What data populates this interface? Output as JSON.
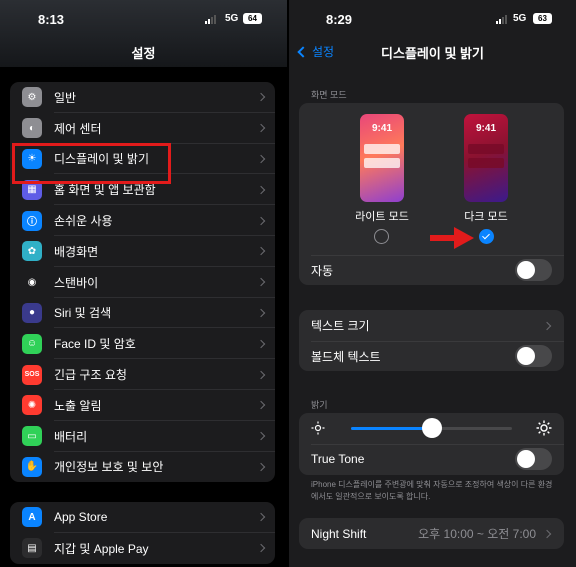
{
  "left": {
    "status": {
      "time": "8:13",
      "network": "5G",
      "battery": "64"
    },
    "nav_title": "설정",
    "group1": [
      {
        "label": "일반",
        "icon": "gear-icon",
        "color": "#8e8e93",
        "glyph": "⚙"
      },
      {
        "label": "제어 센터",
        "icon": "toggles-icon",
        "color": "#8e8e93",
        "glyph": "◐"
      },
      {
        "label": "디스플레이 및 밝기",
        "icon": "brightness-icon",
        "color": "#0a84ff",
        "glyph": "☀"
      },
      {
        "label": "홈 화면 및 앱 보관함",
        "icon": "home-grid-icon",
        "color": "#5e5ce6",
        "glyph": "▦"
      },
      {
        "label": "손쉬운 사용",
        "icon": "accessibility-icon",
        "color": "#0a84ff",
        "glyph": "ⓘ"
      },
      {
        "label": "배경화면",
        "icon": "wallpaper-icon",
        "color": "#30b0c7",
        "glyph": "✿"
      },
      {
        "label": "스탠바이",
        "icon": "standby-icon",
        "color": "#1c1c1e",
        "glyph": "◉"
      },
      {
        "label": "Siri 및 검색",
        "icon": "siri-icon",
        "color": "#3a3a8c",
        "glyph": "●"
      },
      {
        "label": "Face ID 및 암호",
        "icon": "faceid-icon",
        "color": "#30d158",
        "glyph": "☺"
      },
      {
        "label": "긴급 구조 요청",
        "icon": "sos-icon",
        "color": "#ff3b30",
        "glyph": "SOS"
      },
      {
        "label": "노출 알림",
        "icon": "exposure-icon",
        "color": "#ff3b30",
        "glyph": "✺"
      },
      {
        "label": "배터리",
        "icon": "battery-icon",
        "color": "#30d158",
        "glyph": "▭"
      },
      {
        "label": "개인정보 보호 및 보안",
        "icon": "hand-icon",
        "color": "#0a84ff",
        "glyph": "✋"
      }
    ],
    "group2": [
      {
        "label": "App Store",
        "icon": "appstore-icon",
        "color": "#0a84ff",
        "glyph": "A"
      },
      {
        "label": "지갑 및 Apple Pay",
        "icon": "wallet-icon",
        "color": "#2c2c2e",
        "glyph": "▤"
      }
    ]
  },
  "right": {
    "status": {
      "time": "8:29",
      "network": "5G",
      "battery": "63"
    },
    "back_label": "설정",
    "nav_title": "디스플레이 및 밝기",
    "screen_mode_header": "화면 모드",
    "preview_time": "9:41",
    "light_mode_label": "라이트 모드",
    "dark_mode_label": "다크 모드",
    "selected_mode": "dark",
    "auto_label": "자동",
    "auto_on": false,
    "text_size_label": "텍스트 크기",
    "bold_text_label": "볼드체 텍스트",
    "bold_on": false,
    "brightness_header": "밝기",
    "brightness_level": 0.5,
    "true_tone_label": "True Tone",
    "true_tone_on": false,
    "true_tone_note": "iPhone 디스플레이를 주변광에 맞춰 자동으로 조정하여 색상이 다른 환경에서도 일관적으로 보이도록 합니다.",
    "night_shift_label": "Night Shift",
    "night_shift_value": "오후 10:00 ~ 오전 7:00"
  },
  "colors": {
    "accent": "#0a84ff",
    "highlight": "#e21b1b"
  }
}
